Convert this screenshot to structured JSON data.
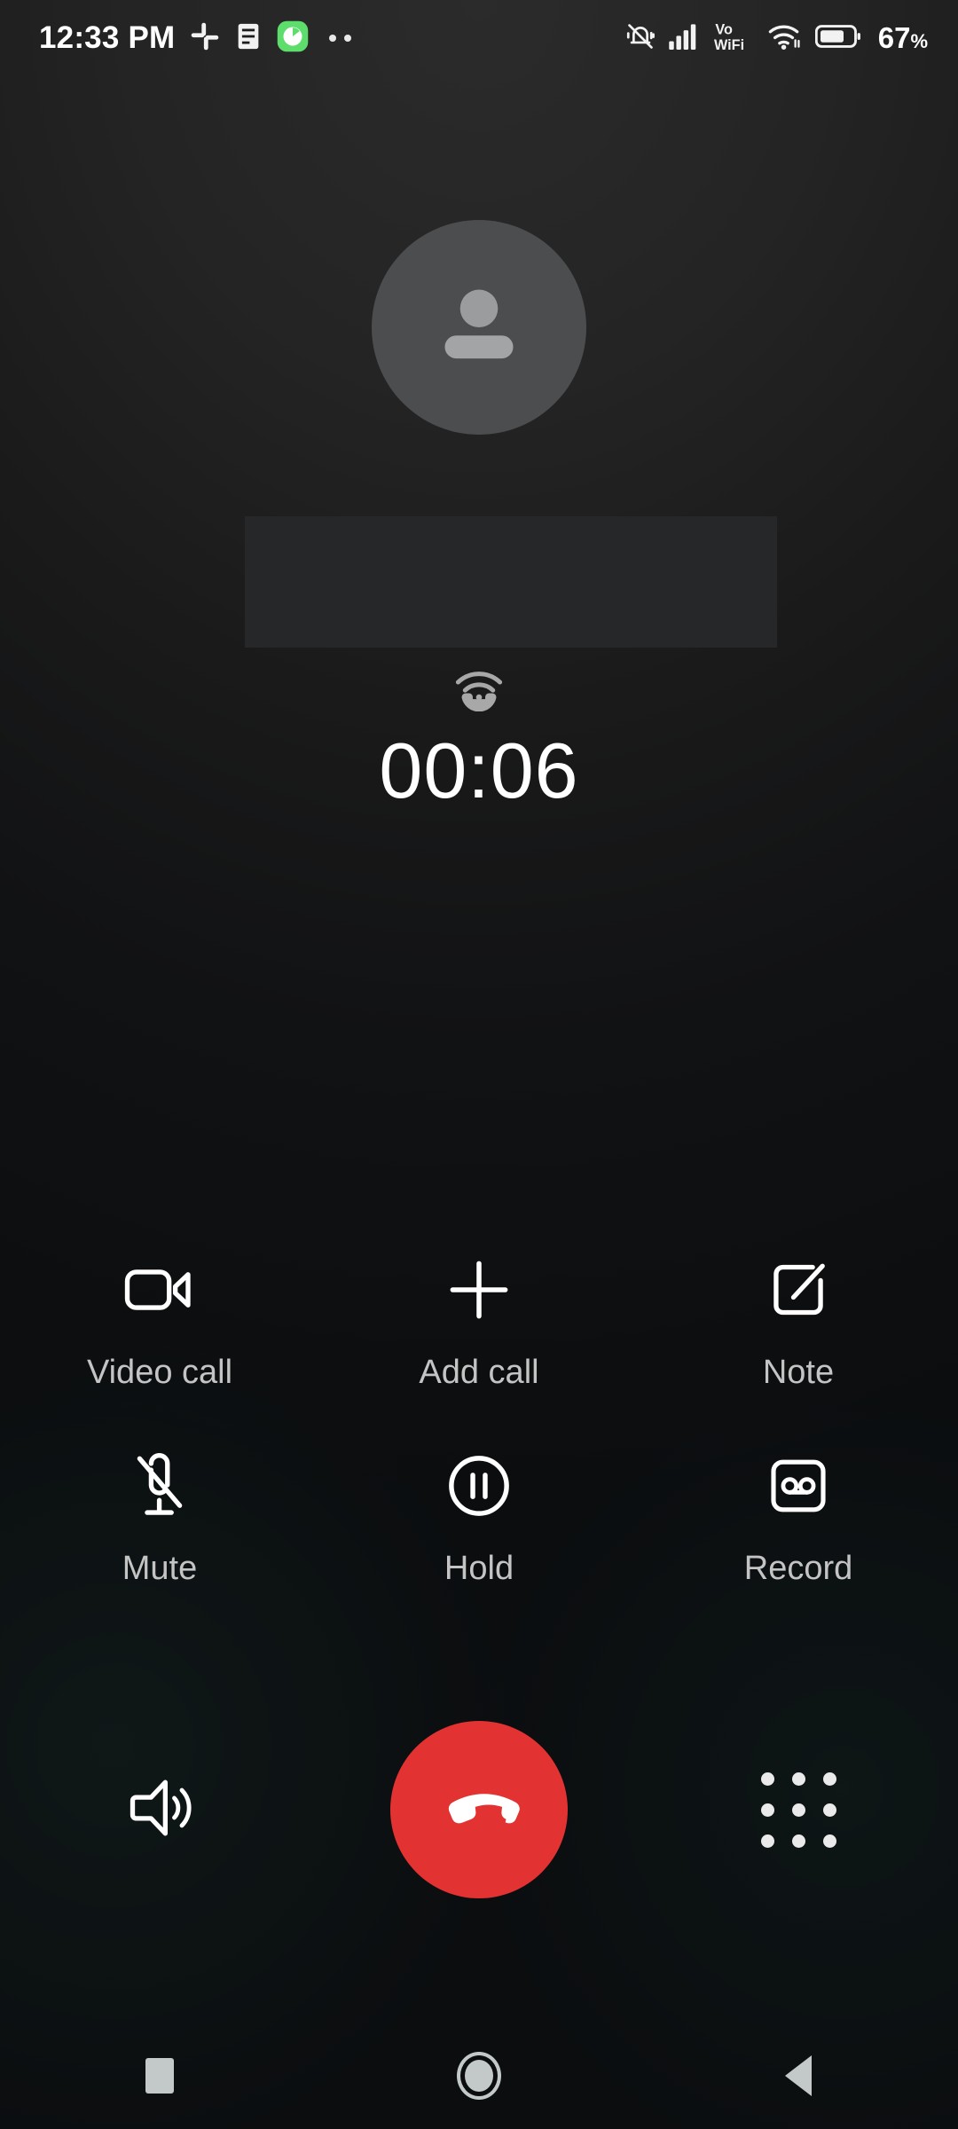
{
  "status_bar": {
    "time": "12:33 PM",
    "battery_percent": "67",
    "percent_symbol": "%",
    "left_icons": [
      {
        "name": "slack-icon",
        "label": "Slack"
      },
      {
        "name": "notes-icon",
        "label": "Notes"
      },
      {
        "name": "timer-app-icon",
        "label": "Timer",
        "color": "#5ddd6b"
      },
      {
        "name": "more-notifications-icon",
        "label": "More notifications"
      }
    ],
    "right_icons": [
      {
        "name": "ringer-silent-icon",
        "label": "Silent mode"
      },
      {
        "name": "cellular-signal-icon",
        "label": "Signal"
      },
      {
        "name": "vowifi-icon",
        "label": "VoWiFi",
        "line1": "Vo",
        "line2": "WiFi"
      },
      {
        "name": "wifi-icon",
        "label": "Wi-Fi"
      },
      {
        "name": "battery-icon",
        "label": "Battery"
      }
    ]
  },
  "call": {
    "avatar_name": "default-contact-avatar",
    "contact_name": "",
    "contact_name_redacted": true,
    "network_badge": "wifi-calling-icon",
    "duration": "00:06",
    "colors": {
      "end_call": "#e23232",
      "avatar_bg": "#4c4d4e",
      "avatar_glyph": "#9b9c9d",
      "label": "#c4c4c4"
    }
  },
  "actions": {
    "row1": [
      {
        "label": "Video call",
        "icon": "video-camera-icon"
      },
      {
        "label": "Add call",
        "icon": "plus-icon"
      },
      {
        "label": "Note",
        "icon": "note-edit-icon"
      }
    ],
    "row2": [
      {
        "label": "Mute",
        "icon": "microphone-off-icon"
      },
      {
        "label": "Hold",
        "icon": "pause-circle-icon"
      },
      {
        "label": "Record",
        "icon": "cassette-record-icon"
      }
    ]
  },
  "bottom_bar": [
    {
      "name": "speaker-button",
      "icon": "speaker-icon",
      "label": "Speaker"
    },
    {
      "name": "end-call-button",
      "icon": "end-call-icon",
      "label": "End call"
    },
    {
      "name": "dialpad-button",
      "icon": "dialpad-icon",
      "label": "Dialpad"
    }
  ],
  "navigation_bar": [
    {
      "name": "recents-button",
      "icon": "square-icon",
      "label": "Recents"
    },
    {
      "name": "home-button",
      "icon": "circle-icon",
      "label": "Home"
    },
    {
      "name": "back-button",
      "icon": "triangle-left-icon",
      "label": "Back"
    }
  ]
}
